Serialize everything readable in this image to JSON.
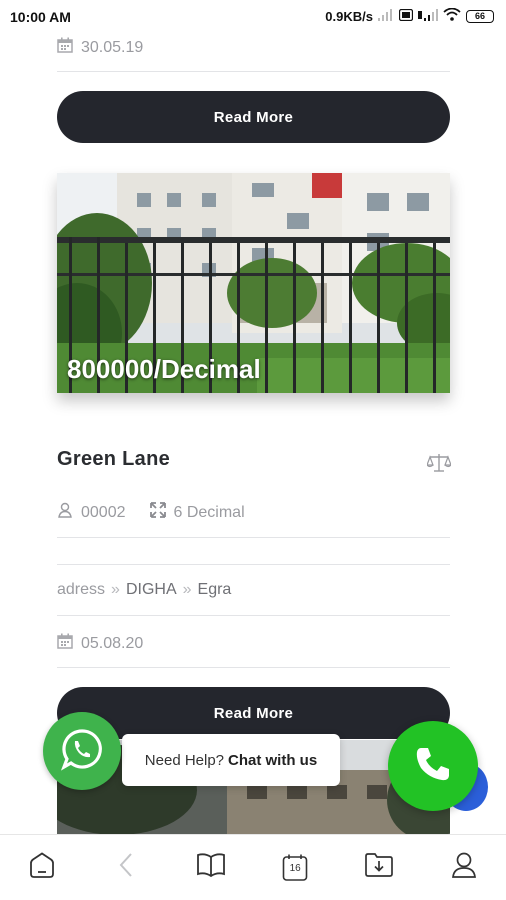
{
  "status_bar": {
    "time": "10:00 AM",
    "network_speed": "0.9KB/s",
    "battery": "66"
  },
  "listing_prev": {
    "date": "30.05.19",
    "read_more": "Read More"
  },
  "listing": {
    "price": "800000/Decimal",
    "title": "Green Lane",
    "id": "00002",
    "area": "6 Decimal",
    "address": {
      "prefix": "adress",
      "level1": "DIGHA",
      "level2": "Egra"
    },
    "date": "05.08.20",
    "read_more": "Read More"
  },
  "chat": {
    "prompt": "Need Help?",
    "action": "Chat with us"
  },
  "bottom_nav": {
    "calendar_day": "16",
    "icons": [
      "home-icon",
      "back-icon",
      "book-icon",
      "calendar-icon",
      "download-icon",
      "profile-icon"
    ]
  },
  "colors": {
    "button_dark": "#24262d",
    "whatsapp_green": "#3fb34c",
    "call_green": "#22c225",
    "meta_gray": "#9a9ba0"
  }
}
